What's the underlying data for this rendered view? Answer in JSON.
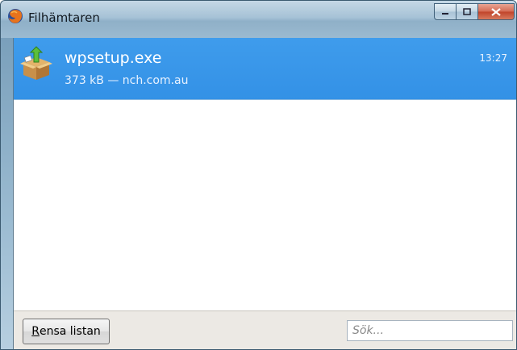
{
  "window": {
    "title": "Filhämtaren",
    "icon": "firefox-icon",
    "controls": [
      "minimize-icon",
      "maximize-icon",
      "close-icon"
    ]
  },
  "downloads": [
    {
      "name": "wpsetup.exe",
      "status": "373 kB — nch.com.au",
      "time": "13:27",
      "icon": "package-icon",
      "selected": true
    }
  ],
  "footer": {
    "clear_label_accesskey": "R",
    "clear_label_rest": "ensa listan",
    "search_placeholder": "Sök..."
  },
  "colors": {
    "selection": "#3391e6",
    "title_bar": "#9bbad0"
  }
}
